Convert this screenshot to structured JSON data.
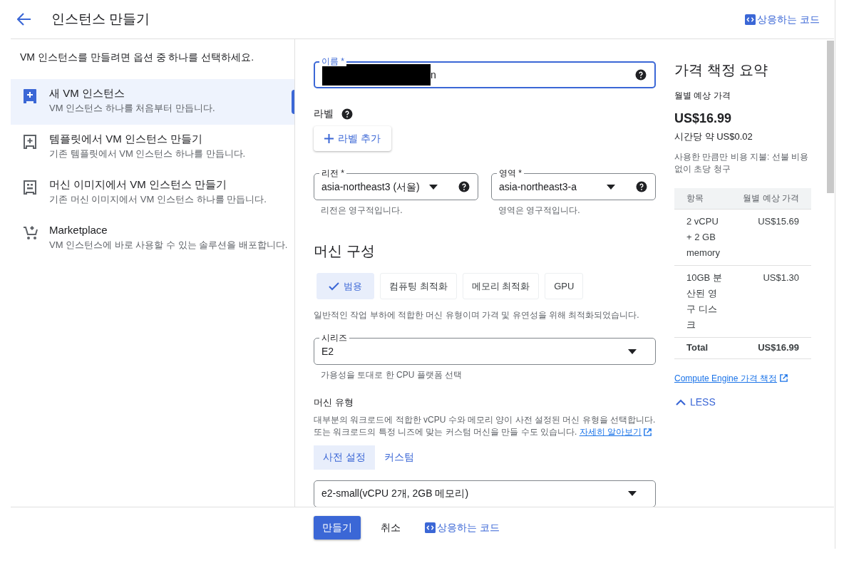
{
  "header": {
    "title": "인스턴스 만들기",
    "code_link": "상응하는 코드"
  },
  "left": {
    "intro": "VM 인스턴스를 만들려면 옵션 중 하나를 선택하세요.",
    "options": [
      {
        "kind": "new",
        "title": "새 VM 인스턴스",
        "description": "VM 인스턴스 하나를 처음부터 만듭니다.",
        "selected": true
      },
      {
        "kind": "template",
        "title": "템플릿에서 VM 인스턴스 만들기",
        "description": "기존 템플릿에서 VM 인스턴스 하나를 만듭니다.",
        "selected": false
      },
      {
        "kind": "image",
        "title": "머신 이미지에서 VM 인스턴스 만들기",
        "description": "기존 머신 이미지에서 VM 인스턴스 하나를 만듭니다.",
        "selected": false
      },
      {
        "kind": "marketplace",
        "title": "Marketplace",
        "description": "VM 인스턴스에 바로 사용할 수 있는 솔루션을 배포합니다.",
        "selected": false
      }
    ]
  },
  "form": {
    "name_field": {
      "label": "이름 *",
      "value": "n"
    },
    "labels": {
      "label": "라벨",
      "add_button": "라벨 추가"
    },
    "region": {
      "label": "리전 *",
      "value": "asia-northeast3 (서울)",
      "helper": "리전은 영구적입니다."
    },
    "zone": {
      "label": "영역 *",
      "value": "asia-northeast3-a",
      "helper": "영역은 영구적입니다."
    },
    "machine_config": {
      "heading": "머신 구성",
      "families": [
        {
          "label": "범용",
          "selected": true
        },
        {
          "label": "컴퓨팅 최적화",
          "selected": false
        },
        {
          "label": "메모리 최적화",
          "selected": false
        },
        {
          "label": "GPU",
          "selected": false
        }
      ],
      "family_description": "일반적인 작업 부하에 적합한 머신 유형이며 가격 및 유연성을 위해 최적화되었습니다.",
      "series": {
        "label": "시리즈",
        "value": "E2",
        "helper": "가용성을 토대로 한 CPU 플랫폼 선택"
      },
      "machine_type": {
        "heading": "머신 유형",
        "description": "대부분의 워크로드에 적합한 vCPU 수와 메모리 양이 사전 설정된 머신 유형을 선택합니다. 또는 워크로드의 특정 니즈에 맞는 커스텀 머신을 만들 수도 있습니다.",
        "link": "자세히 알아보기",
        "tabs": [
          {
            "label": "사전 설정",
            "selected": true
          },
          {
            "label": "커스텀",
            "selected": false
          }
        ],
        "select_value": "e2-small(vCPU 2개, 2GB 메모리)"
      }
    }
  },
  "pricing": {
    "title": "가격 책정 요약",
    "monthly_label": "월별 예상 가격",
    "monthly_price": "US$16.99",
    "hourly": "시간당 약 US$0.02",
    "note": "사용한 만큼만 비용 지불: 선불 비용 없이 초당 청구",
    "columns": [
      "항목",
      "월별 예상 가격"
    ],
    "rows": [
      {
        "item": "2 vCPU + 2 GB memory",
        "price": "US$15.69"
      },
      {
        "item": "10GB 분산된 영구 디스크",
        "price": "US$1.30"
      }
    ],
    "total": {
      "label": "Total",
      "price": "US$16.99"
    },
    "link": "Compute Engine 가격 책정",
    "less": "LESS"
  },
  "footer": {
    "create": "만들기",
    "cancel": "취소",
    "code": "상응하는 코드"
  }
}
